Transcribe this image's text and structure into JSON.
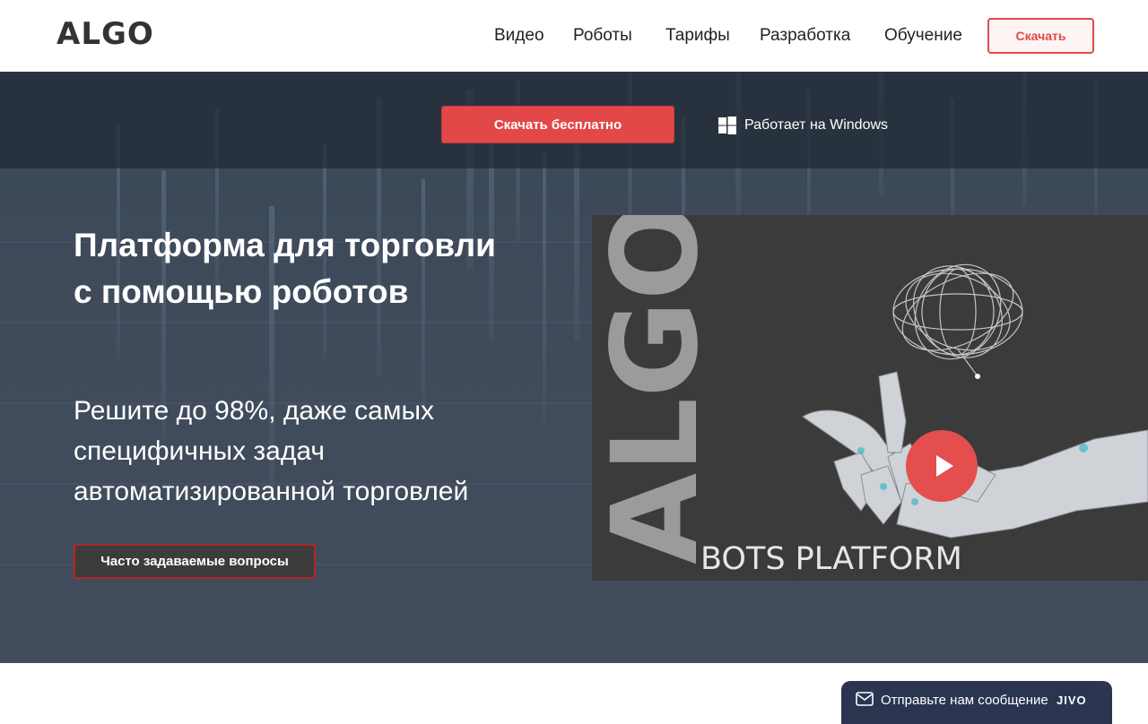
{
  "header": {
    "logo": "ALGO",
    "nav": [
      {
        "label": "Видео"
      },
      {
        "label": "Роботы"
      },
      {
        "label": "Тарифы"
      },
      {
        "label": "Разработка"
      },
      {
        "label": "Обучение"
      }
    ],
    "download_label": "Скачать"
  },
  "topbar": {
    "download_free_label": "Скачать бесплатно",
    "platform_note": "Работает на Windows",
    "platform_icon": "windows-icon"
  },
  "hero": {
    "title": "Платформа для торговли с помощью роботов",
    "subtitle": "Решите до 98%, даже самых специфичных задач автоматизированной торговлей",
    "faq_label": "Часто задаваемые вопросы"
  },
  "video": {
    "brand_vertical": "ALGO",
    "caption": "BOTS PLATFORM",
    "play_icon": "play-icon"
  },
  "chat": {
    "label": "Отправьте нам сообщение",
    "brand": "JIVO",
    "icon": "mail-icon"
  },
  "colors": {
    "accent": "#e24848",
    "hero_bg": "#3f4b5b",
    "chat_bg": "#2b3550",
    "text_dark": "#222222"
  }
}
